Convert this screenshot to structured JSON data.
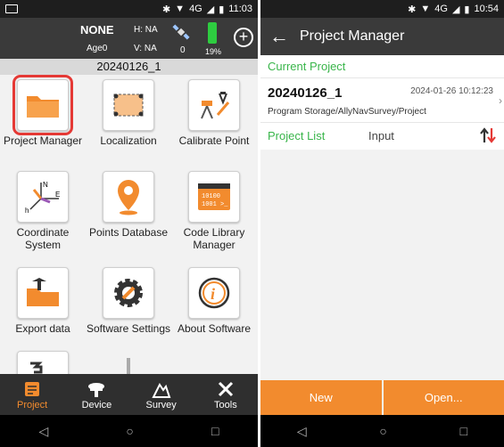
{
  "left": {
    "status_time": "11:03",
    "status_net": "4G",
    "header": {
      "solution": "NONE",
      "h": "H: NA",
      "age": "Age0",
      "v": "V: NA",
      "sat_count": "0",
      "battery_pct": "19%"
    },
    "project_title": "20240126_1",
    "tiles": [
      {
        "label": "Project Manager"
      },
      {
        "label": "Localization"
      },
      {
        "label": "Calibrate Point"
      },
      {
        "label": "Coordinate System"
      },
      {
        "label": "Points Database"
      },
      {
        "label": "Code Library Manager"
      },
      {
        "label": "Export data"
      },
      {
        "label": "Software Settings"
      },
      {
        "label": "About Software"
      }
    ],
    "nav": [
      {
        "label": "Project"
      },
      {
        "label": "Device"
      },
      {
        "label": "Survey"
      },
      {
        "label": "Tools"
      }
    ]
  },
  "right": {
    "status_time": "10:54",
    "status_net": "4G",
    "title": "Project Manager",
    "current_project_label": "Current Project",
    "current_project": {
      "name": "20240126_1",
      "date": "2024-01-26 10:12:23",
      "path": "Program Storage/AllyNavSurvey/Project"
    },
    "project_list_label": "Project List",
    "input_label": "Input",
    "buttons": {
      "new": "New",
      "open": "Open..."
    }
  },
  "colors": {
    "accent": "#f28b2e",
    "green": "#39b54a",
    "header": "#3a3a3a",
    "highlight": "#e53935"
  }
}
